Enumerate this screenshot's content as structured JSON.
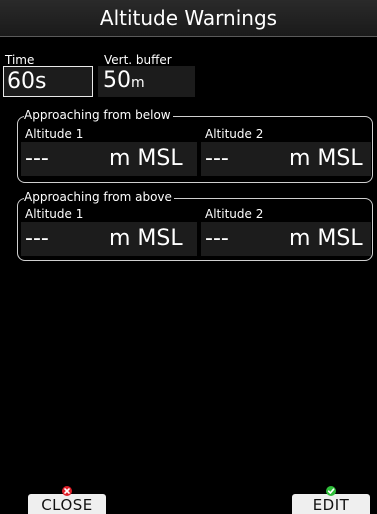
{
  "title": "Altitude Warnings",
  "time": {
    "label": "Time",
    "value": "60s"
  },
  "vert_buffer": {
    "label": "Vert. buffer",
    "value": "50",
    "unit": "m"
  },
  "below": {
    "legend": "Approaching from below",
    "alt1": {
      "label": "Altitude 1",
      "value": "---",
      "unit": "m MSL"
    },
    "alt2": {
      "label": "Altitude 2",
      "value": "---",
      "unit": "m MSL"
    }
  },
  "above": {
    "legend": "Approaching from above",
    "alt1": {
      "label": "Altitude 1",
      "value": "---",
      "unit": "m MSL"
    },
    "alt2": {
      "label": "Altitude 2",
      "value": "---",
      "unit": "m MSL"
    }
  },
  "softkeys": {
    "close": {
      "label": "CLOSE",
      "icon": "close-icon",
      "color": "#e0202a"
    },
    "edit": {
      "label": "EDIT",
      "icon": "check-icon",
      "color": "#2fbf3a"
    }
  }
}
